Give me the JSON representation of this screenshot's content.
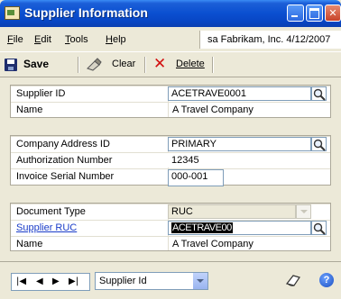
{
  "window": {
    "title": "Supplier Information"
  },
  "menu": {
    "items": [
      {
        "mnemonic": "F",
        "rest": "ile"
      },
      {
        "mnemonic": "E",
        "rest": "dit"
      },
      {
        "mnemonic": "T",
        "rest": "ools"
      },
      {
        "mnemonic": "H",
        "rest": "elp"
      }
    ],
    "status": "sa  Fabrikam, Inc.  4/12/2007"
  },
  "toolbar": {
    "save_label": "Save",
    "clear_label": "Clear",
    "delete_label": "Delete"
  },
  "form": {
    "supplier_id_label": "Supplier ID",
    "supplier_id_value": "ACETRAVE0001",
    "name_label": "Name",
    "name_value": "A Travel Company",
    "company_address_label": "Company Address ID",
    "company_address_value": "PRIMARY",
    "authorization_label": "Authorization Number",
    "authorization_value": "12345",
    "invoice_serial_label": "Invoice Serial Number",
    "invoice_serial_value": "000-001",
    "document_type_label": "Document Type",
    "document_type_value": "RUC",
    "supplier_ruc_label": "Supplier RUC",
    "supplier_ruc_value": "ACETRAVE00",
    "name2_label": "Name",
    "name2_value": "A Travel Company"
  },
  "bottom": {
    "nav": [
      "|◀",
      "◀",
      "▶",
      "▶|"
    ],
    "sort_by": "Supplier Id"
  },
  "icons": {
    "lookup": "magnifier-icon",
    "note": "note-icon",
    "help": "help-icon",
    "help_glyph": "?"
  }
}
